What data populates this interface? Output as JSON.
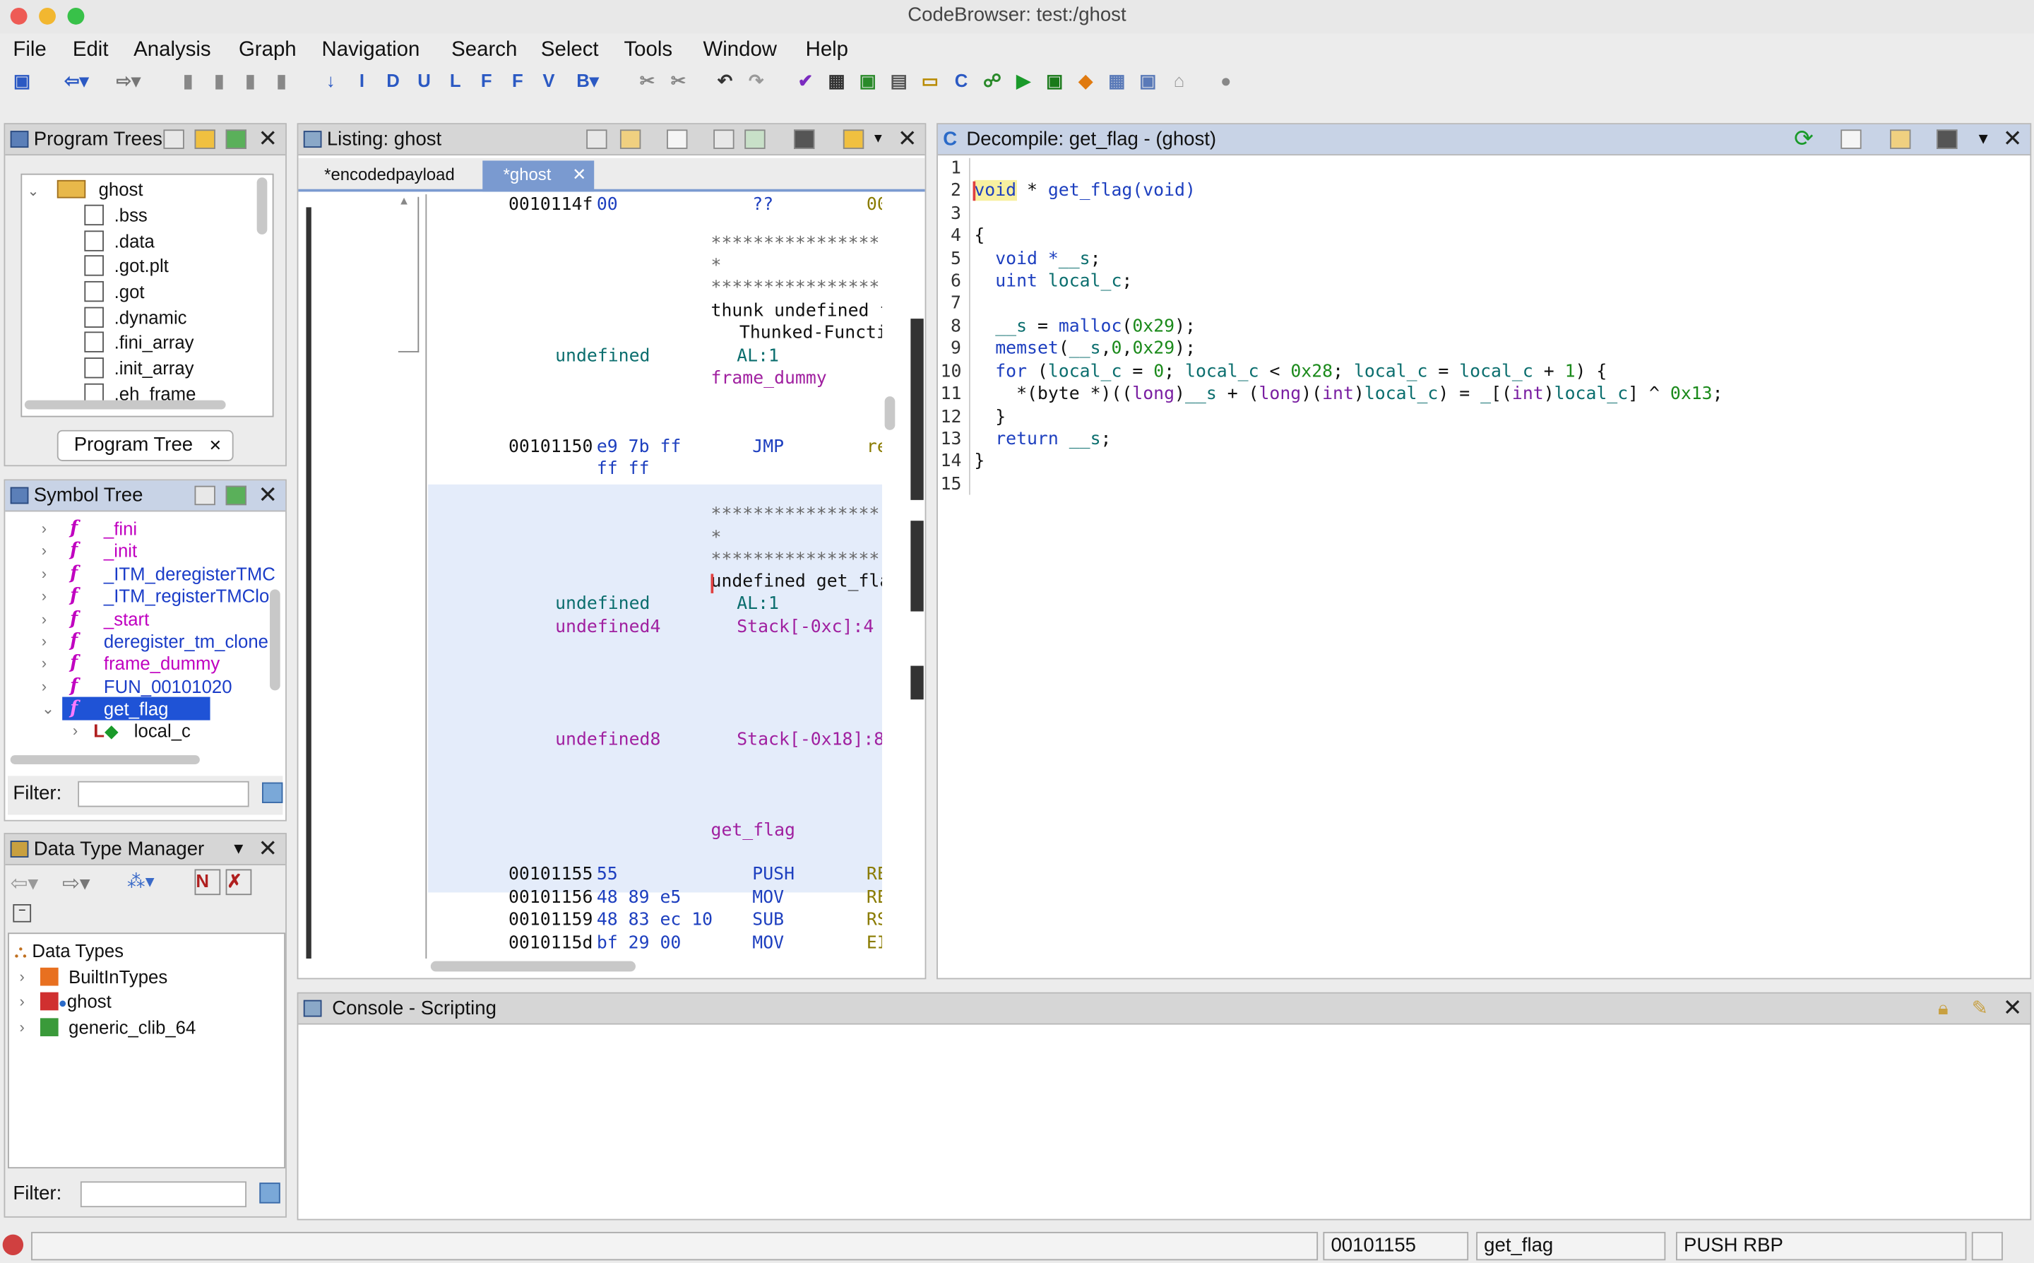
{
  "window": {
    "title": "CodeBrowser: test:/ghost"
  },
  "menu": [
    "File",
    "Edit",
    "Analysis",
    "Graph",
    "Navigation",
    "Search",
    "Select",
    "Tools",
    "Window",
    "Help"
  ],
  "program_trees": {
    "title": "Program Trees",
    "root": "ghost",
    "items": [
      ".bss",
      ".data",
      ".got.plt",
      ".got",
      ".dynamic",
      ".fini_array",
      ".init_array",
      ".eh_frame"
    ],
    "tab": "Program Tree"
  },
  "symbol_tree": {
    "title": "Symbol Tree",
    "items": [
      "_fini",
      "_init",
      "_ITM_deregisterTMC",
      "_ITM_registerTMClo",
      "_start",
      "deregister_tm_clone",
      "frame_dummy",
      "FUN_00101020",
      "get_flag"
    ],
    "children": [
      "local_c"
    ],
    "filter_label": "Filter:"
  },
  "dtm": {
    "title": "Data Type Manager",
    "root": "Data Types",
    "items": [
      "BuiltInTypes",
      "ghost",
      "generic_clib_64"
    ],
    "filter_label": "Filter:"
  },
  "listing": {
    "title": "Listing:  ghost",
    "tabs": [
      "*encodedpayload",
      "*ghost"
    ],
    "rows": {
      "r1_addr": "0010114f",
      "r1_bytes": "00",
      "r1_mn": "??",
      "r1_op": "00",
      "stars1": "****************",
      "star1": "*",
      "stars2": "****************",
      "thunk": "thunk undefined f",
      "thunked": "Thunked-Functi",
      "undef1": "undefined",
      "al1": "AL:1",
      "fd_label": "frame_dummy",
      "r2_addr": "00101150",
      "r2_bytes": "e9 7b ff",
      "r2_mn": "JMP",
      "r2_op": "re",
      "r2_bytes2": "ff ff",
      "stars3": "****************",
      "star2": "*",
      "stars4": "****************",
      "undef_gf": "undefined get_fla",
      "undef2": "undefined",
      "al2": "AL:1",
      "undef4": "undefined4",
      "stk1": "Stack[-0xc]:4",
      "undef8": "undefined8",
      "stk2": "Stack[-0x18]:8",
      "gf_label": "get_flag",
      "i1_addr": "00101155",
      "i1_bytes": "55",
      "i1_mn": "PUSH",
      "i1_op": "RE",
      "i2_addr": "00101156",
      "i2_bytes": "48 89 e5",
      "i2_mn": "MOV",
      "i2_op": "RE",
      "i3_addr": "00101159",
      "i3_bytes": "48 83 ec 10",
      "i3_mn": "SUB",
      "i3_op": "RS",
      "i4_addr": "0010115d",
      "i4_bytes": "bf 29 00",
      "i4_mn": "MOV",
      "i4_op": "EI"
    }
  },
  "decompile": {
    "title": "Decompile: get_flag -  (ghost)",
    "line_numbers": [
      "1",
      "2",
      "3",
      "4",
      "5",
      "6",
      "7",
      "8",
      "9",
      "10",
      "11",
      "12",
      "13",
      "14",
      "15"
    ],
    "code": {
      "l2_void": "void",
      "l2_rest": " * ",
      "l2_fn": "get_flag",
      "l2_args": "(void)",
      "l4": "{",
      "l5_a": "  void *",
      "l5_b": "__s",
      "l5_c": ";",
      "l6_a": "  uint ",
      "l6_b": "local_c",
      "l6_c": ";",
      "l8_a": "  ",
      "l8_b": "__s",
      "l8_c": " = ",
      "l8_d": "malloc",
      "l8_e": "(",
      "l8_f": "0x29",
      "l8_g": ");",
      "l9_a": "  ",
      "l9_b": "memset",
      "l9_c": "(",
      "l9_d": "__s",
      "l9_e": ",",
      "l9_f": "0",
      "l9_g": ",",
      "l9_h": "0x29",
      "l9_i": ");",
      "l10_a": "  for",
      "l10_b": " (",
      "l10_c": "local_c",
      "l10_d": " = ",
      "l10_e": "0",
      "l10_f": "; ",
      "l10_g": "local_c",
      "l10_h": " < ",
      "l10_i": "0x28",
      "l10_j": "; ",
      "l10_k": "local_c",
      "l10_l": " = ",
      "l10_m": "local_c",
      "l10_n": " + ",
      "l10_o": "1",
      "l10_p": ") {",
      "l11_a": "    *(byte *)((",
      "l11_b": "long",
      "l11_c": ")",
      "l11_d": "__s",
      "l11_e": " + (",
      "l11_f": "long",
      "l11_g": ")(",
      "l11_h": "int",
      "l11_i": ")",
      "l11_j": "local_c",
      "l11_k": ") = ",
      "l11_l": "_",
      "l11_m": "[(",
      "l11_n": "int",
      "l11_o": ")",
      "l11_p": "local_c",
      "l11_q": "] ^ ",
      "l11_r": "0x13",
      "l11_s": ";",
      "l12": "  }",
      "l13_a": "  return ",
      "l13_b": "__s",
      "l13_c": ";",
      "l14": "}"
    }
  },
  "console": {
    "title": "Console - Scripting"
  },
  "status": {
    "address": "00101155",
    "function": "get_flag",
    "instruction": "PUSH RBP"
  }
}
